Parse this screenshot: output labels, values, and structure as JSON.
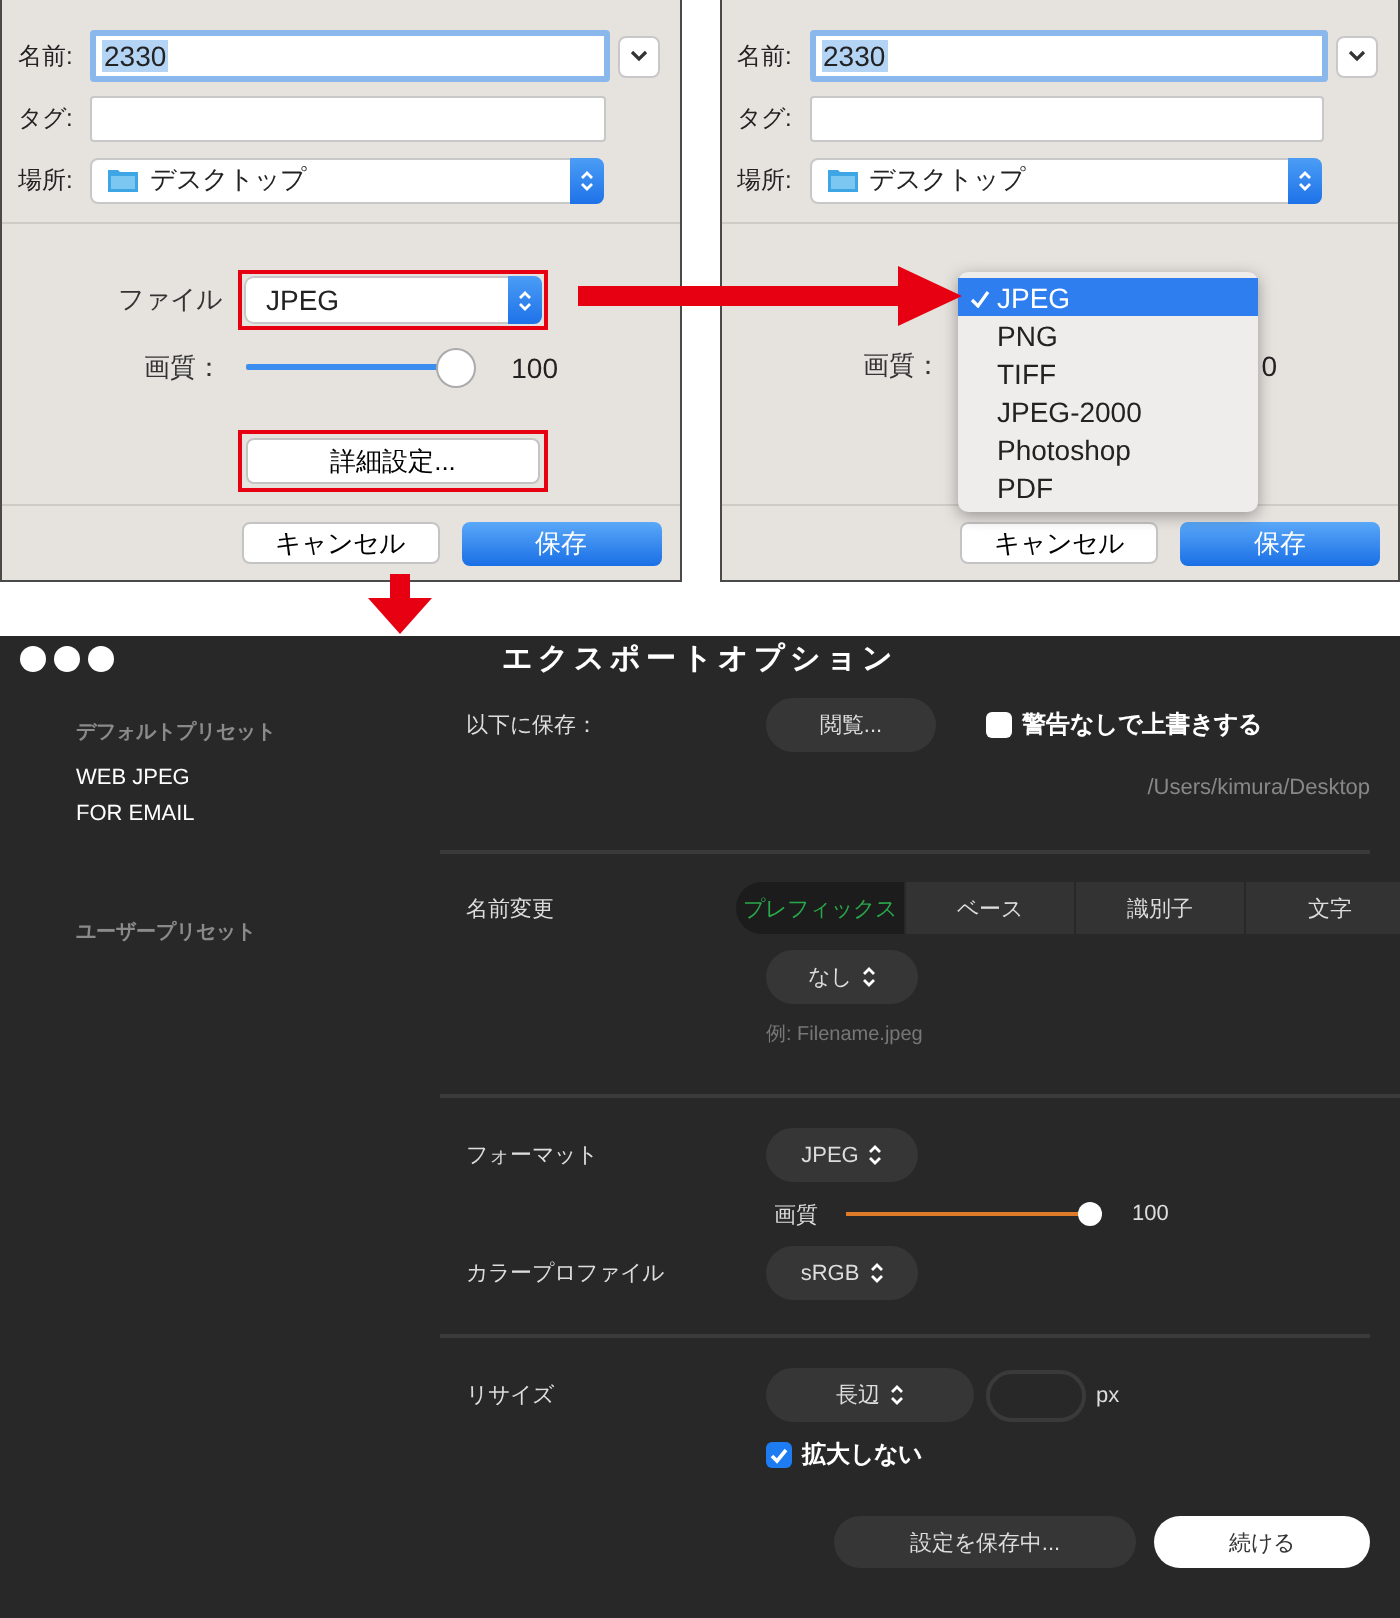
{
  "save_dialogs": [
    {
      "name_label": "名前:",
      "name_value": "2330",
      "tag_label": "タグ:",
      "location_label": "場所:",
      "location_value": "デスクトップ",
      "file_label": "ファイル",
      "format_value": "JPEG",
      "file_highlighted": true,
      "quality_label": "画質：",
      "quality_slider": {
        "level": 1
      },
      "quality_value": "100",
      "details_button": "詳細設定...",
      "details_highlighted": true,
      "cancel": "キャンセル",
      "save": "保存"
    },
    {
      "name_label": "名前:",
      "name_value": "2330",
      "tag_label": "タグ:",
      "location_label": "場所:",
      "location_value": "デスクトップ",
      "format_menu": [
        {
          "label": "JPEG",
          "selected": true
        },
        {
          "label": "PNG",
          "selected": false
        },
        {
          "label": "TIFF",
          "selected": false
        },
        {
          "label": "JPEG-2000",
          "selected": false
        },
        {
          "label": "Photoshop",
          "selected": false
        },
        {
          "label": "PDF",
          "selected": false
        }
      ],
      "quality_label": "画質：",
      "quality_value": "0",
      "cancel": "キャンセル",
      "save": "保存"
    }
  ],
  "export_window": {
    "title": "エクスポートオプション",
    "sidebar": [
      {
        "heading": "デフォルトプリセット",
        "items": [
          "WEB JPEG",
          "FOR EMAIL"
        ]
      },
      {
        "heading": "ユーザープリセット"
      }
    ],
    "save_to": {
      "label": "以下に保存：",
      "browse": "閲覧...",
      "overwrite_label": "警告なしで上書きする",
      "overwrite_checked": false,
      "path": "/Users/kimura/Desktop"
    },
    "rename": {
      "label": "名前変更",
      "tabs": [
        {
          "label": "プレフィックス",
          "selected": true
        },
        {
          "label": "ベース",
          "selected": false
        },
        {
          "label": "識別子",
          "selected": false
        },
        {
          "label": "文字",
          "selected": false
        }
      ],
      "prefix": "なし",
      "example": "例: Filename.jpeg"
    },
    "format": {
      "label": "フォーマット",
      "value": "JPEG",
      "quality_label": "画質",
      "quality_slider": {
        "level": 1
      },
      "quality_value": "100",
      "color_profile_label": "カラープロファイル",
      "color_profile": "sRGB"
    },
    "resize": {
      "label": "リサイズ",
      "mode": "長辺",
      "unit": "px",
      "no_enlarge_label": "拡大しない",
      "no_enlarge_checked": true
    },
    "buttons": {
      "save_settings": "設定を保存中...",
      "continue": "続ける"
    }
  }
}
